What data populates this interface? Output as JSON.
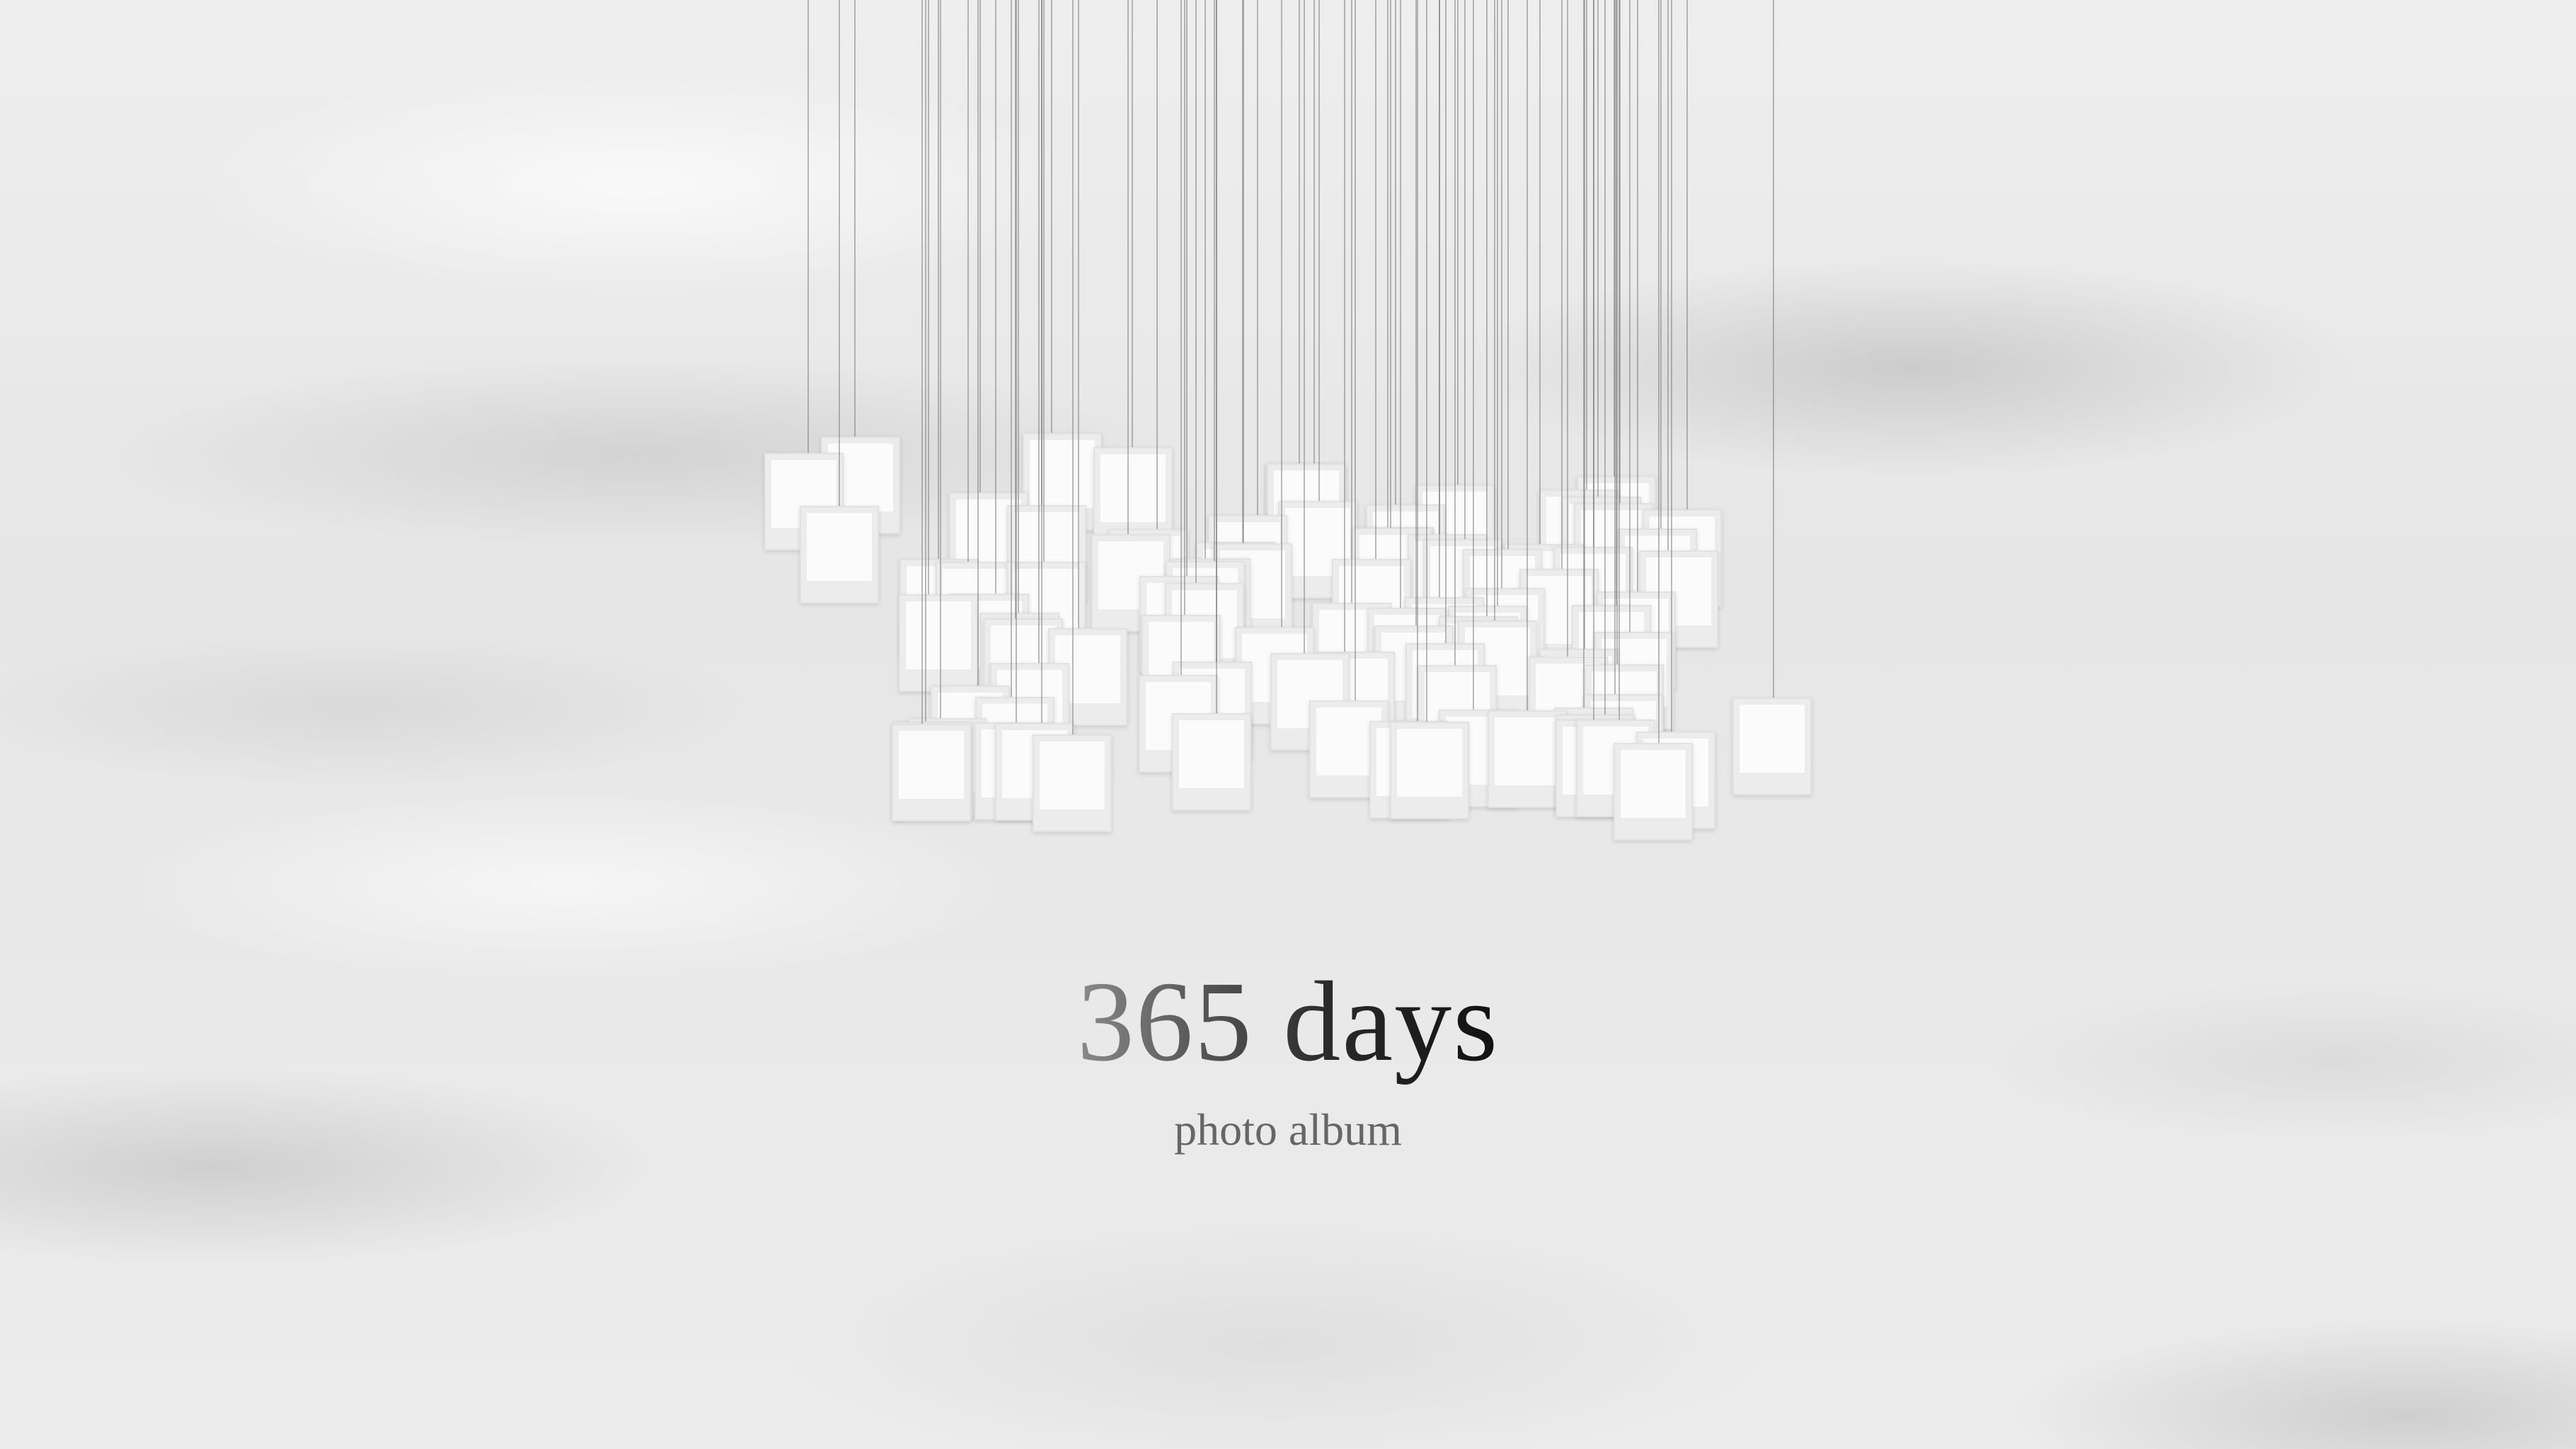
{
  "hero": {
    "title": "365 days",
    "subtitle": "photo album"
  },
  "gallery": {
    "photo_count": 90
  }
}
